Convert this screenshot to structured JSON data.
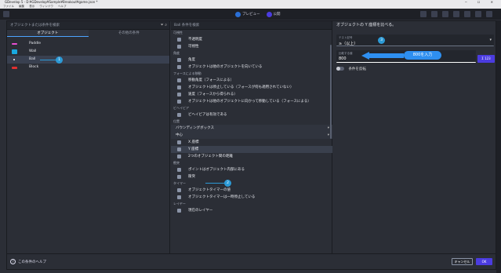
{
  "window": {
    "title": "GDevelop 5 - D:¥GDevelop¥Sample¥Breakout¥game.json *",
    "controls": "─ ☐ ✕"
  },
  "menubar": [
    "ファイル",
    "編集",
    "表示",
    "ウィンドウ",
    "ヘルプ"
  ],
  "toolbar": {
    "preview_label": "プレビュー",
    "publish_label": "公開"
  },
  "left": {
    "search_placeholder": "オブジェクトまたは条件を検索",
    "tabs": [
      {
        "label": "オブジェクト"
      },
      {
        "label": "その他の条件"
      }
    ],
    "objects": [
      {
        "name": "Paddle",
        "color": "#e84fd2"
      },
      {
        "name": "Wall",
        "color": "#19a9e0"
      },
      {
        "name": "Ball",
        "color": "#ffffff"
      },
      {
        "name": "Block",
        "color": "#e03030"
      }
    ],
    "callout": "1"
  },
  "middle": {
    "search_placeholder": "Ball 条件を検索",
    "items": [
      {
        "kind": "head",
        "label": "可視性"
      },
      {
        "kind": "cond",
        "label": "不透明度"
      },
      {
        "kind": "cond",
        "label": "可視性"
      },
      {
        "kind": "head",
        "label": "角度"
      },
      {
        "kind": "cond",
        "label": "角度"
      },
      {
        "kind": "cond",
        "label": "オブジェクトは他のオブジェクトを向いている"
      },
      {
        "kind": "head",
        "label": "フォースによる移動"
      },
      {
        "kind": "cond",
        "label": "移動角度（フォースによる）"
      },
      {
        "kind": "cond",
        "label": "オブジェクトは停止している（フォースが何も適用されていない）"
      },
      {
        "kind": "cond",
        "label": "速度（フォースから得られる）"
      },
      {
        "kind": "cond",
        "label": "オブジェクトは他のオブジェクトに向かって移動している（フォースによる）"
      },
      {
        "kind": "head",
        "label": "ビヘイビア"
      },
      {
        "kind": "cond",
        "label": "ビヘイビアは有効である"
      },
      {
        "kind": "head",
        "label": "位置"
      },
      {
        "kind": "folder",
        "label": "バウンディングボックス"
      },
      {
        "kind": "folder",
        "label": "中心"
      },
      {
        "kind": "cond",
        "label": "X 座標"
      },
      {
        "kind": "cond",
        "label": "Y 座標",
        "selected": true
      },
      {
        "kind": "cond",
        "label": "2つのオブジェクト間の距離"
      },
      {
        "kind": "head",
        "label": "衝突"
      },
      {
        "kind": "cond",
        "label": "ポイントはオブジェクト内部にある"
      },
      {
        "kind": "cond",
        "label": "衝突"
      },
      {
        "kind": "head",
        "label": "タイマー"
      },
      {
        "kind": "cond",
        "label": "オブジェクトタイマーの値"
      },
      {
        "kind": "cond",
        "label": "オブジェクトタイマーは一時停止している"
      },
      {
        "kind": "head",
        "label": "レイヤー"
      },
      {
        "kind": "cond",
        "label": "現在のレイヤー"
      }
    ],
    "callout": "2"
  },
  "right": {
    "title": "オブジェクトの Y 座標を比べる。",
    "test_sign_label": "テスト記号",
    "test_sign_value": "≥（以上）",
    "compare_label": "比較する値",
    "compare_value": "800",
    "expr_button": "123",
    "invert_label": "条件を反転",
    "callout": "3",
    "annotation": "800を入力"
  },
  "footer": {
    "help_label": "この条件のヘルプ",
    "cancel_label": "キャンセル",
    "ok_label": "OK"
  },
  "colors": {
    "accent": "#4b3ce0",
    "callout": "#2c9ad6",
    "annotation": "#2e8ff0"
  }
}
